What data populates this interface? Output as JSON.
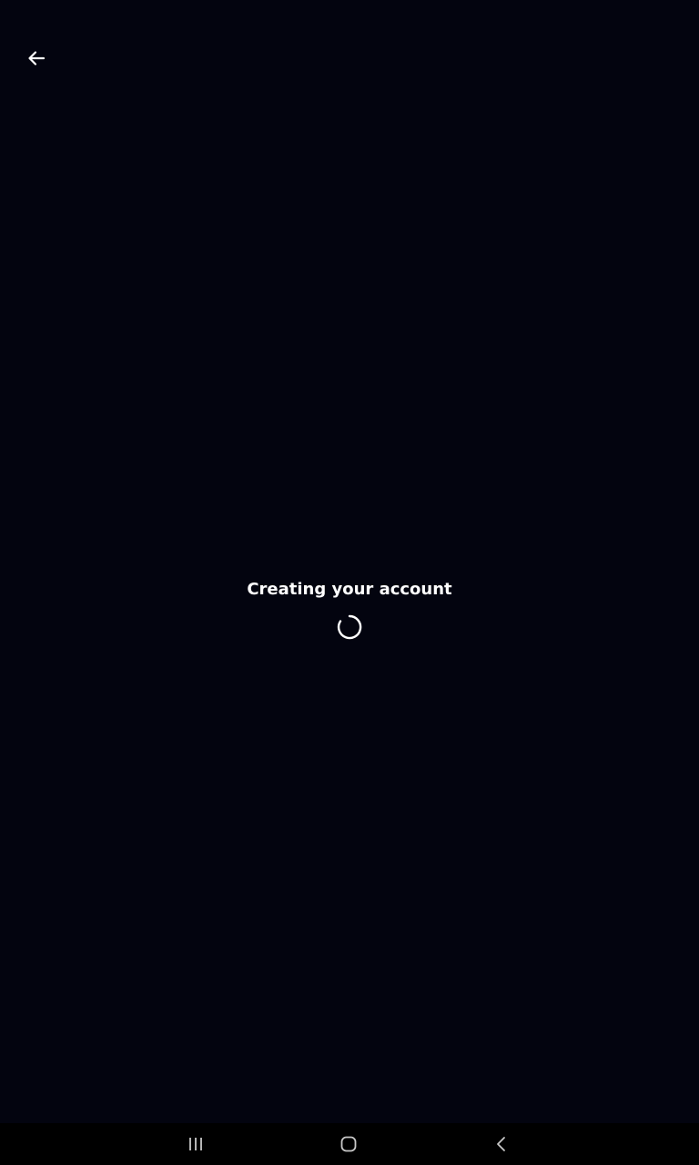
{
  "app": {
    "loading_message": "Creating your account"
  },
  "icons": {
    "back": "arrow-left-icon",
    "spinner": "loading-spinner-icon",
    "nav_recents": "recents-icon",
    "nav_home": "home-icon",
    "nav_back": "chevron-left-icon"
  },
  "colors": {
    "background": "#03040f",
    "text": "#ffffff",
    "nav_background": "#000000",
    "nav_icon": "#c8c8c8"
  }
}
